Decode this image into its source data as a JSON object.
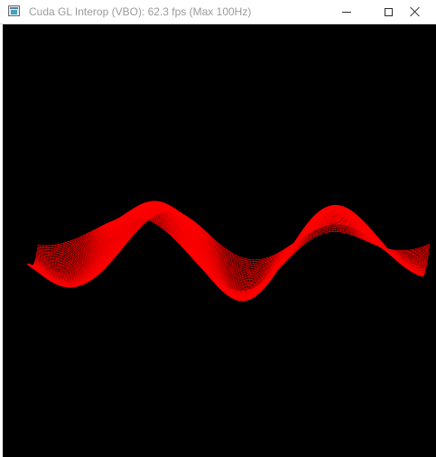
{
  "window": {
    "title": "Cuda GL Interop (VBO): 62.3 fps (Max 100Hz)",
    "icon": "app-window-icon",
    "controls": {
      "minimize_icon": "minimize-icon",
      "maximize_icon": "maximize-icon",
      "close_icon": "close-icon"
    }
  },
  "render": {
    "background_color": "#000000",
    "mesh_color": "#ff0000",
    "content": "wireframe sine-wave mesh"
  }
}
